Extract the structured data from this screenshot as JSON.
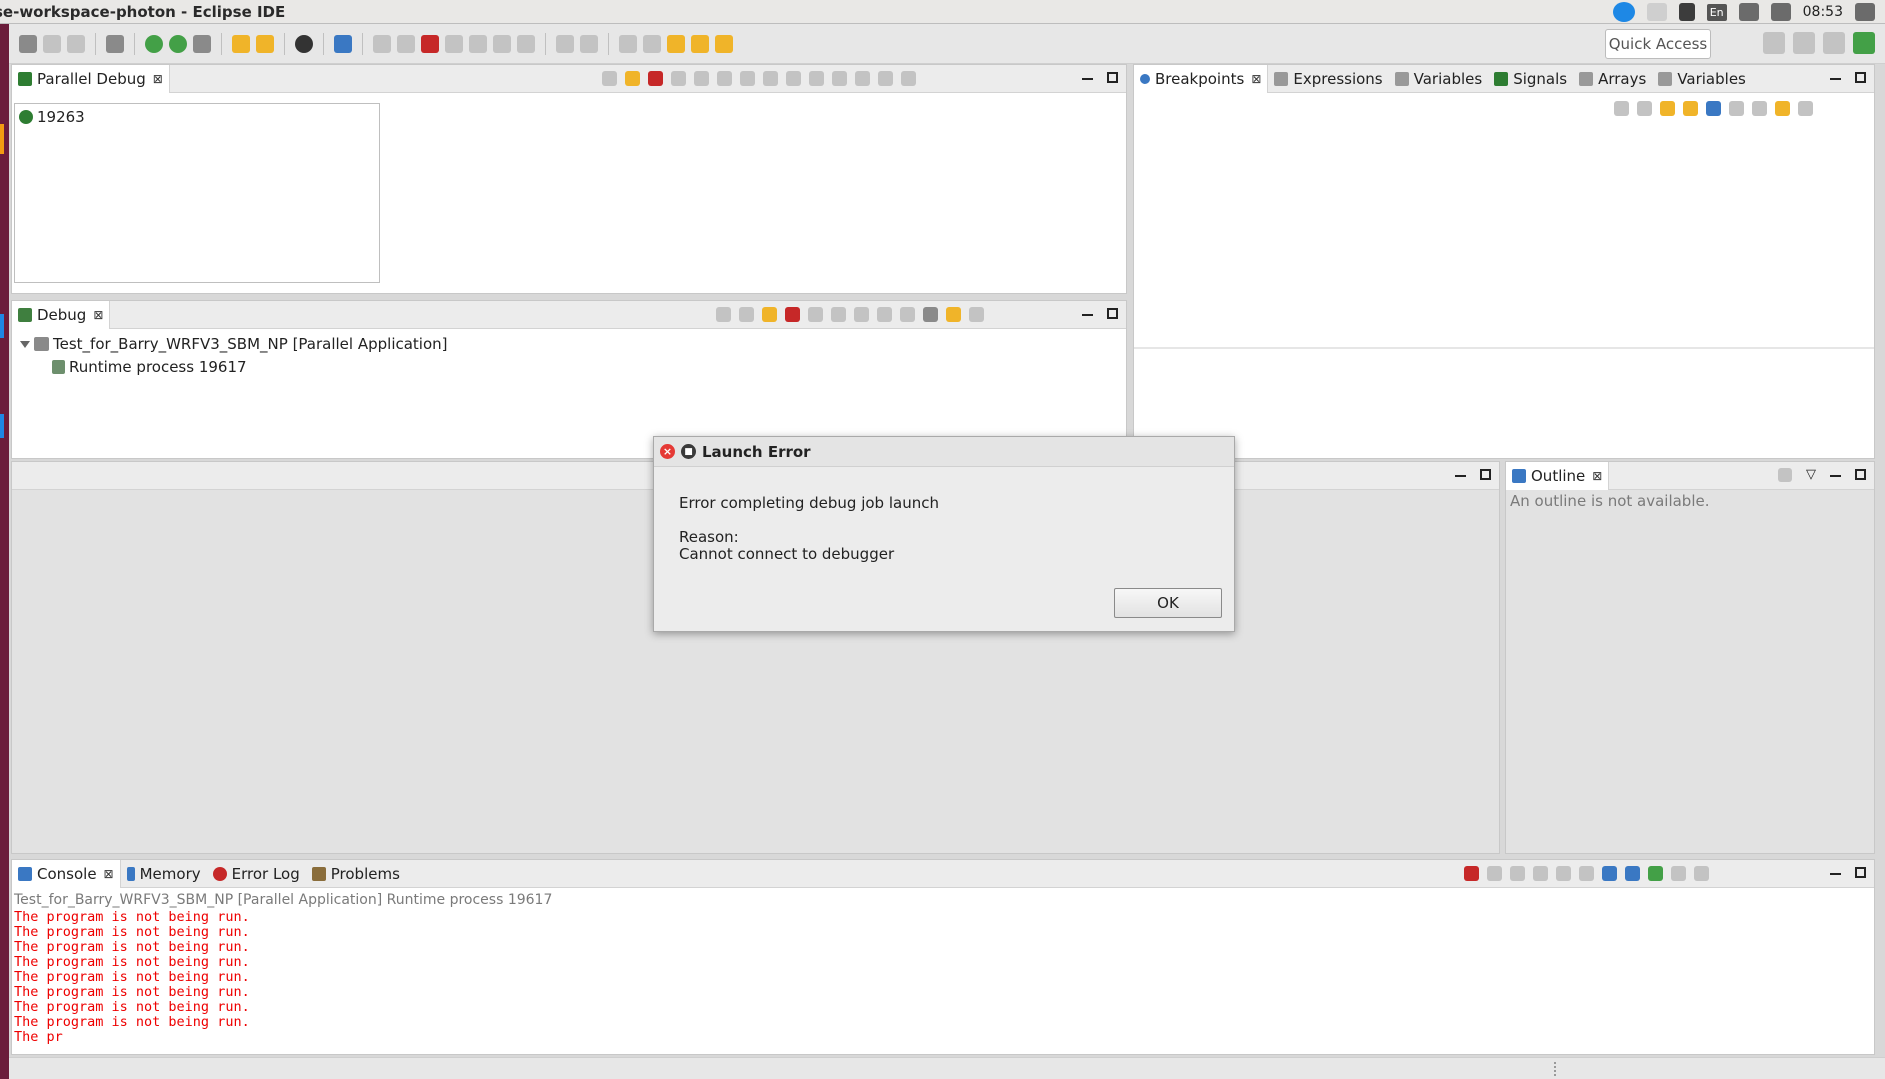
{
  "window": {
    "title": "se-workspace-photon - Eclipse IDE"
  },
  "system_tray": {
    "keyboard_layout": "En",
    "clock": "08:53"
  },
  "toolbar": {
    "quick_access": "Quick Access"
  },
  "parallel_debug": {
    "tab_label": "Parallel Debug",
    "job_id": "19263"
  },
  "right_top_panel": {
    "tabs": [
      {
        "label": "Breakpoints",
        "active": true
      },
      {
        "label": "Expressions",
        "active": false
      },
      {
        "label": "Variables",
        "active": false
      },
      {
        "label": "Signals",
        "active": false
      },
      {
        "label": "Arrays",
        "active": false
      },
      {
        "label": "Variables",
        "active": false
      }
    ]
  },
  "debug": {
    "tab_label": "Debug",
    "launch": "Test_for_Barry_WRFV3_SBM_NP [Parallel Application]",
    "process": "Runtime process 19617"
  },
  "outline": {
    "tab_label": "Outline",
    "message": "An outline is not available."
  },
  "bottom_panel": {
    "tabs": [
      {
        "label": "Console",
        "active": true
      },
      {
        "label": "Memory",
        "active": false
      },
      {
        "label": "Error Log",
        "active": false
      },
      {
        "label": "Problems",
        "active": false
      }
    ],
    "console_header": "Test_for_Barry_WRFV3_SBM_NP [Parallel Application] Runtime process 19617",
    "console_lines": [
      "The program is not being run.",
      "The program is not being run.",
      "The program is not being run.",
      "The program is not being run.",
      "The program is not being run.",
      "The program is not being run.",
      "The program is not being run.",
      "The program is not being run.",
      "The pr"
    ]
  },
  "dialog": {
    "title": "Launch Error",
    "message": "Error completing debug job launch",
    "reason_label": "Reason:",
    "reason": "Cannot connect to debugger",
    "ok_label": "OK"
  },
  "colors": {
    "console_error": "#e00000",
    "launcher": "#6b1d3b",
    "dialog_close": "#e53935"
  }
}
